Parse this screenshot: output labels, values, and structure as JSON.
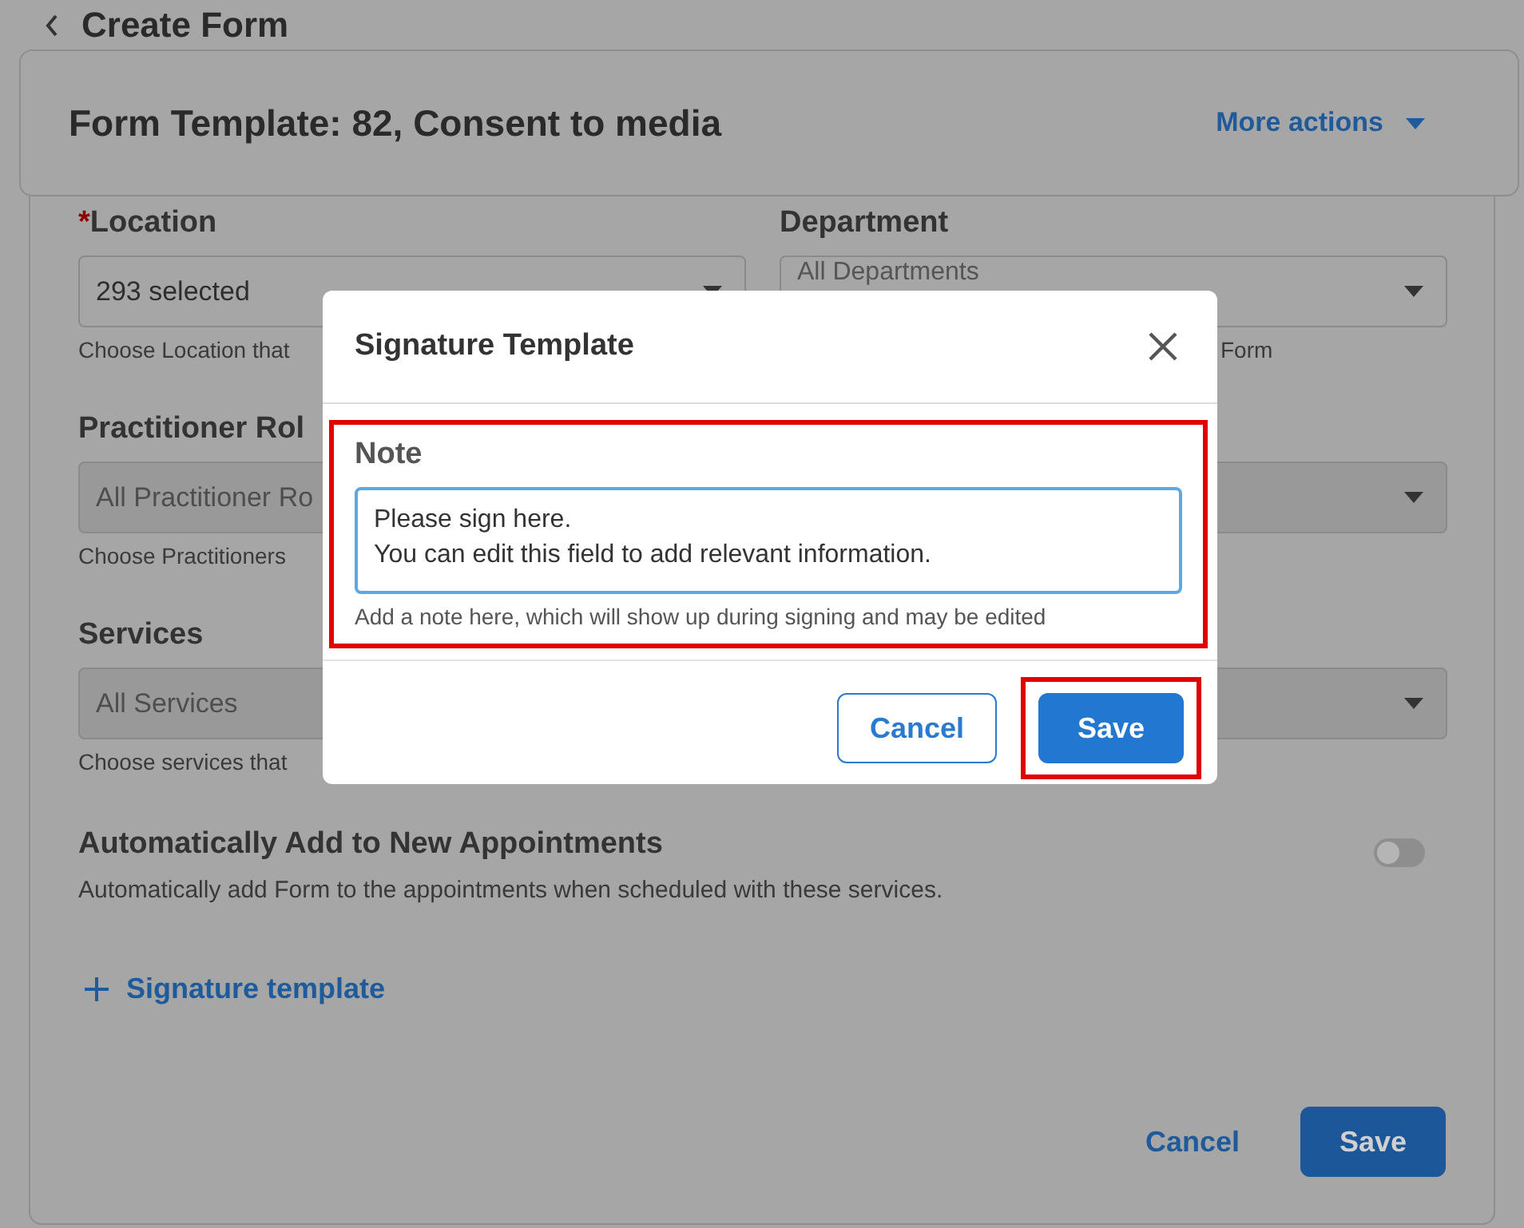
{
  "page": {
    "title": "Create Form"
  },
  "header": {
    "title": "Form Template: 82, Consent to media",
    "actions_label": "More actions"
  },
  "rows": [
    {
      "left": {
        "label": "Location",
        "required": true,
        "required_mark": "*",
        "value": "293 selected",
        "hint": "Choose Location that",
        "disabled": false,
        "caret": true
      },
      "right": {
        "label": "Department",
        "placeholder": "All Departments",
        "hint": "Form",
        "disabled": false,
        "caret": true
      }
    },
    {
      "left": {
        "label": "Practitioner Rol",
        "placeholder": "All Practitioner Ro",
        "hint": "Choose Practitioners",
        "disabled": true,
        "caret": false
      },
      "right": {
        "disabled": true,
        "caret": true
      }
    },
    {
      "left": {
        "label": "Services",
        "placeholder": "All Services",
        "hint": "Choose services that",
        "disabled": true,
        "caret": false
      },
      "right": {
        "disabled": true,
        "caret": true
      }
    }
  ],
  "auto_add": {
    "title": "Automatically Add to New Appointments",
    "description": "Automatically add Form to the appointments when scheduled with these services.",
    "on": false
  },
  "add_link": {
    "label": "Signature template"
  },
  "footer": {
    "buttons": [
      {
        "label": "Cancel",
        "kind": "text"
      },
      {
        "label": "Save",
        "kind": "primary"
      }
    ]
  },
  "dialog": {
    "title": "Signature Template",
    "note": {
      "label": "Note",
      "value": "Please sign here.\nYou can edit this field to add relevant information.",
      "hint": "Add a note here, which will show up during signing and may be edited",
      "highlighted": true
    },
    "buttons": [
      {
        "label": "Cancel",
        "kind": "secondary",
        "highlighted": false
      },
      {
        "label": "Save",
        "kind": "primary",
        "highlighted": true
      }
    ]
  }
}
